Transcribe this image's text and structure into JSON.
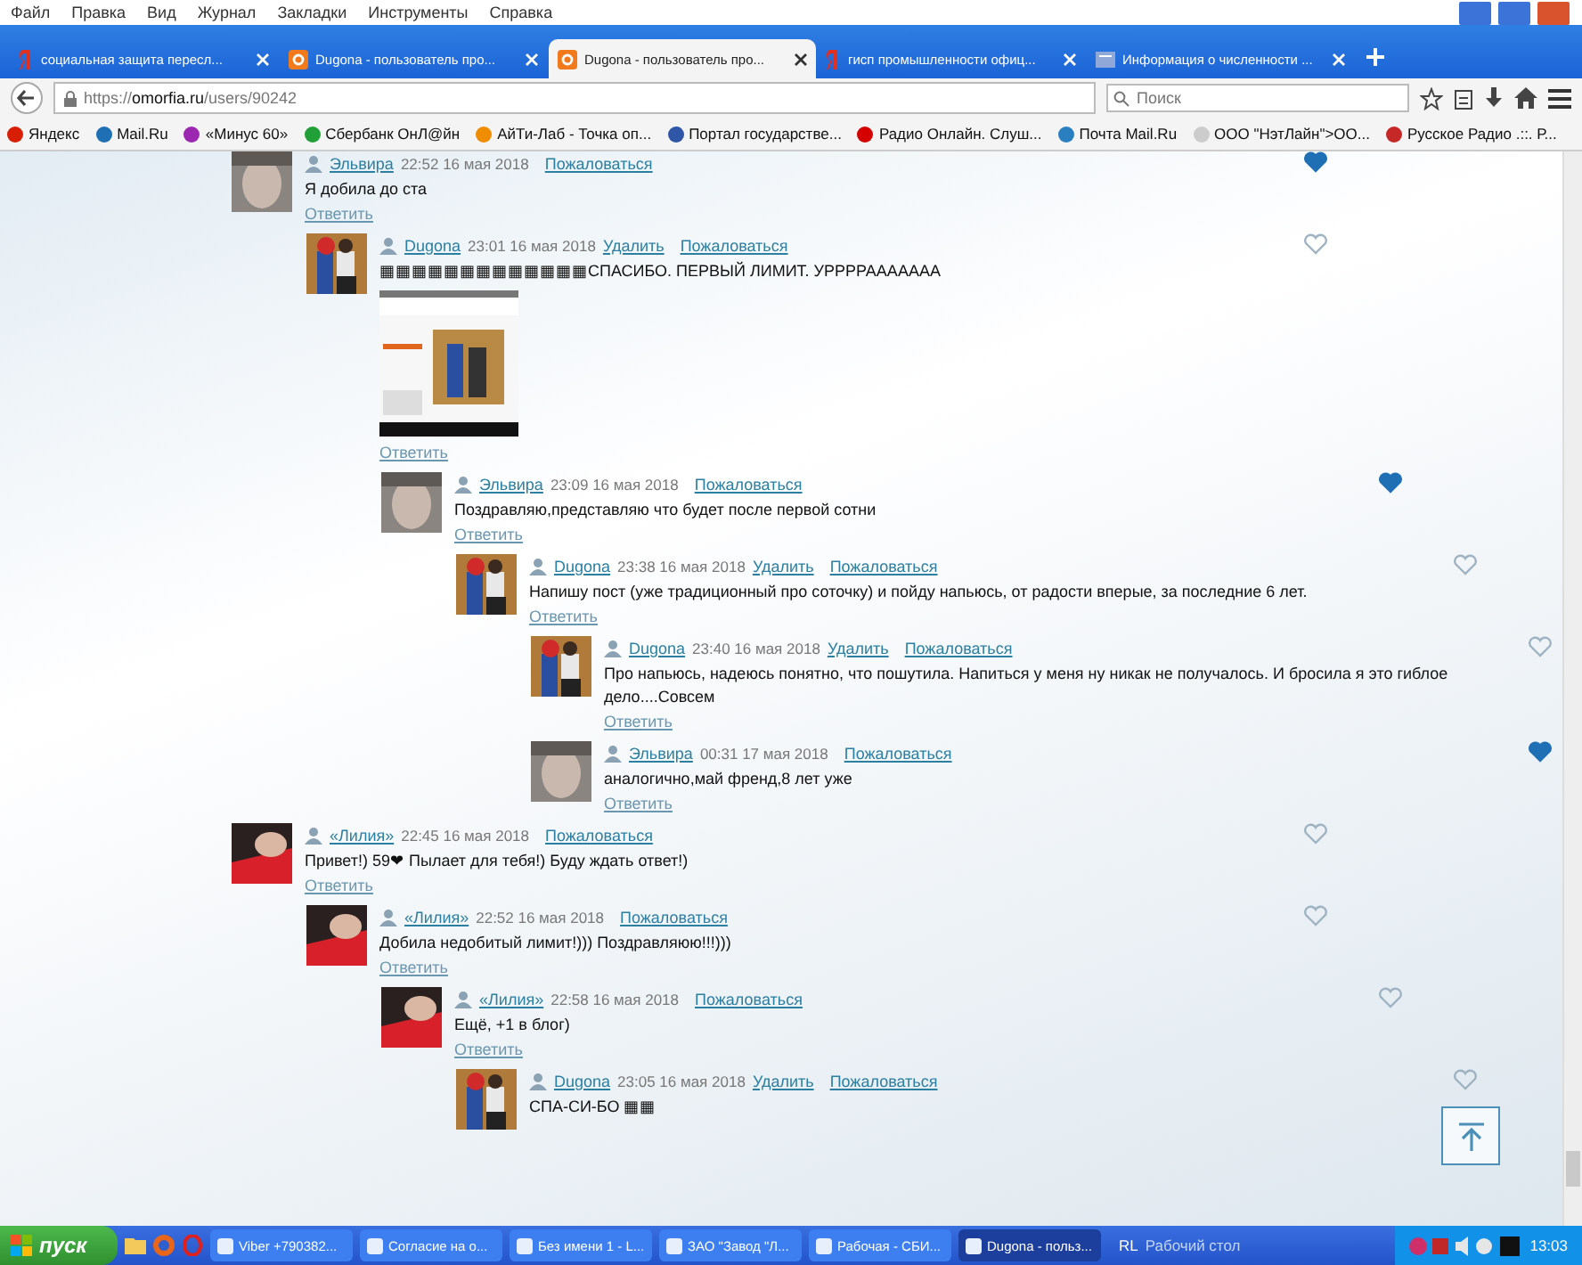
{
  "menu": [
    "Файл",
    "Правка",
    "Вид",
    "Журнал",
    "Закладки",
    "Инструменты",
    "Справка"
  ],
  "tabs": [
    {
      "title": "социальная защита пересл...",
      "kind": "yandex",
      "selected": false
    },
    {
      "title": "Dugona - пользователь про...",
      "kind": "site",
      "selected": false
    },
    {
      "title": "Dugona - пользователь про...",
      "kind": "site",
      "selected": true
    },
    {
      "title": "гисп промышленности офиц...",
      "kind": "yandex",
      "selected": false
    },
    {
      "title": "Информация о численности ...",
      "kind": "page",
      "selected": false
    }
  ],
  "address": {
    "scheme": "https://",
    "host": "omorfia.ru",
    "path": "/users/90242"
  },
  "search": {
    "placeholder": "Поиск"
  },
  "bookmarks": [
    {
      "label": "Яндекс",
      "color": "#d81e05"
    },
    {
      "label": "Mail.Ru",
      "color": "#1f6fb5"
    },
    {
      "label": "«Минус 60»",
      "color": "#9c27b0"
    },
    {
      "label": "Сбербанк ОнЛ@йн",
      "color": "#21a038"
    },
    {
      "label": "АйТи-Лаб - Точка оп...",
      "color": "#f08c00"
    },
    {
      "label": "Портал государстве...",
      "color": "#3056a8"
    },
    {
      "label": "Радио Онлайн. Слуш...",
      "color": "#d50000"
    },
    {
      "label": "Почта Mail.Ru",
      "color": "#2a7fc0"
    },
    {
      "label": "ООО \"НэтЛайн\">ОО...",
      "color": "#cccccc"
    },
    {
      "label": "Русское Радио .::. Р...",
      "color": "#c62828"
    }
  ],
  "comments": [
    {
      "author": "Эльвира",
      "time": "22:52 16 мая 2018",
      "report": "Пожаловаться",
      "text": "Я добила до ста",
      "reply": "Ответить",
      "liked": true,
      "avatar": {
        "kind": "dark"
      },
      "children": [
        {
          "author": "Dugona",
          "time": "23:01 16 мая 2018",
          "delete": "Удалить",
          "report": "Пожаловаться",
          "text": "▦▦▦▦▦▦▦▦▦▦▦▦▦СПАСИБО. ПЕРВЫЙ ЛИМИТ. УРРРРААААААА",
          "attachment": {
            "kind": "picture"
          },
          "reply": "Ответить",
          "liked": false,
          "avatar": {
            "kind": "costume"
          },
          "children": [
            {
              "author": "Эльвира",
              "time": "23:09 16 мая 2018",
              "report": "Пожаловаться",
              "text": "Поздравляю,представляю что будет после первой сотни",
              "reply": "Ответить",
              "liked": true,
              "avatar": {
                "kind": "dark"
              },
              "children": [
                {
                  "author": "Dugona",
                  "time": "23:38 16 мая 2018",
                  "delete": "Удалить",
                  "report": "Пожаловаться",
                  "text": "Напишу пост (уже традиционный про соточку) и пойду напьюсь, от радости вперые, за последние 6 лет.",
                  "reply": "Ответить",
                  "liked": false,
                  "avatar": {
                    "kind": "costume"
                  },
                  "children": [
                    {
                      "author": "Dugona",
                      "time": "23:40 16 мая 2018",
                      "delete": "Удалить",
                      "report": "Пожаловаться",
                      "text": "Про напьюсь, надеюсь понятно, что пошутила. Напиться у меня ну никак не получалось. И бросила я это гиблое дело....Совсем",
                      "reply": "Ответить",
                      "liked": false,
                      "avatar": {
                        "kind": "costume"
                      }
                    },
                    {
                      "author": "Эльвира",
                      "time": "00:31 17 мая 2018",
                      "report": "Пожаловаться",
                      "text": "аналогично,май френд,8 лет уже",
                      "reply": "Ответить",
                      "liked": true,
                      "avatar": {
                        "kind": "dark"
                      }
                    }
                  ]
                }
              ]
            }
          ]
        }
      ]
    },
    {
      "author": "«Лилия»",
      "time": "22:45 16 мая 2018",
      "report": "Пожаловаться",
      "text": "Привет!) 59❤ Пылает для тебя!) Буду ждать ответ!)",
      "reply": "Ответить",
      "liked": false,
      "avatar": {
        "kind": "red"
      },
      "children": [
        {
          "author": "«Лилия»",
          "time": "22:52 16 мая 2018",
          "report": "Пожаловаться",
          "text": "Добила недобитый лимит!))) Поздравляюю!!!)))",
          "reply": "Ответить",
          "liked": false,
          "avatar": {
            "kind": "red"
          },
          "children": [
            {
              "author": "«Лилия»",
              "time": "22:58 16 мая 2018",
              "report": "Пожаловаться",
              "text": "Ещё, +1 в блог)",
              "reply": "Ответить",
              "liked": false,
              "avatar": {
                "kind": "red"
              },
              "children": [
                {
                  "author": "Dugona",
                  "time": "23:05 16 мая 2018",
                  "delete": "Удалить",
                  "report": "Пожаловаться",
                  "text": "СПА-СИ-БО ▦▦",
                  "liked": false,
                  "avatar": {
                    "kind": "costume"
                  }
                }
              ]
            }
          ]
        }
      ]
    }
  ],
  "taskbar": {
    "start": "пуск",
    "items": [
      {
        "label": "Viber +790382...",
        "selected": false
      },
      {
        "label": "Согласие на о...",
        "selected": false
      },
      {
        "label": "Без имени 1 - L...",
        "selected": false
      },
      {
        "label": "ЗАО \"Завод \"Л...",
        "selected": false
      },
      {
        "label": "Рабочая - СБИ...",
        "selected": false
      },
      {
        "label": "Dugona - польз...",
        "selected": true
      }
    ],
    "lang": "RL",
    "desktop": "Рабочий стол",
    "clock": "13:03"
  }
}
